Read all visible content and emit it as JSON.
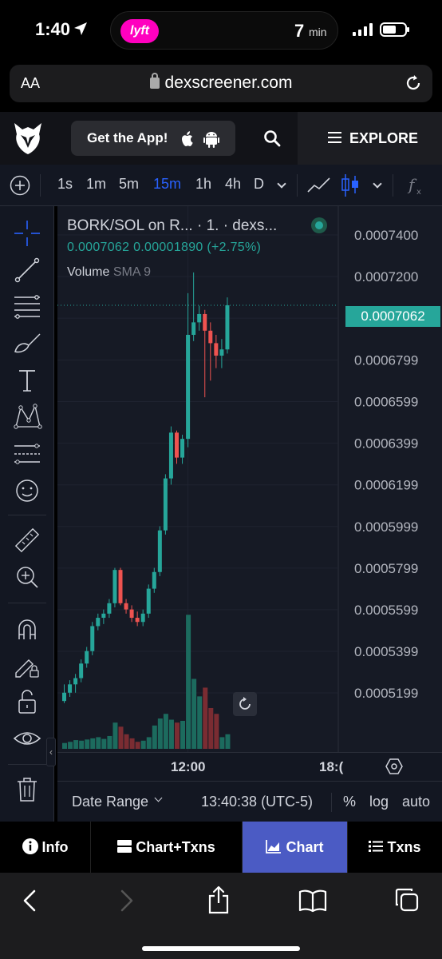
{
  "status_bar": {
    "time": "1:40",
    "eta_number": "7",
    "eta_unit": "min",
    "lyft_label": "lyft"
  },
  "browser": {
    "aa_label": "AA",
    "url": "dexscreener.com"
  },
  "header": {
    "get_app_label": "Get the App!",
    "explore_label": "EXPLORE"
  },
  "toolbar": {
    "intervals": [
      "1s",
      "1m",
      "5m",
      "15m",
      "1h",
      "4h",
      "D"
    ],
    "active_interval": "15m"
  },
  "legend": {
    "title": "BORK/SOL on R...  · 1. · dexs...",
    "values": "0.0007062  0.00001890 (+2.75%)",
    "volume_label": "Volume",
    "volume_indicator": "SMA 9"
  },
  "price_axis": {
    "labels": [
      "0.0007400",
      "0.0007200",
      "0.0007000",
      "0.0006799",
      "0.0006599",
      "0.0006399",
      "0.0006199",
      "0.0005999",
      "0.0005799",
      "0.0005599",
      "0.0005399",
      "0.0005199"
    ],
    "current_price": "0.0007062"
  },
  "time_axis": {
    "labels": [
      "12:00",
      "18:("
    ]
  },
  "bottom_bar": {
    "date_range": "Date Range",
    "clock": "13:40:38 (UTC-5)",
    "percent": "%",
    "log": "log",
    "auto": "auto"
  },
  "tabs": [
    {
      "label": "Info",
      "active": false
    },
    {
      "label": "Chart+Txns",
      "active": false
    },
    {
      "label": "Chart",
      "active": true
    },
    {
      "label": "Txns",
      "active": false
    }
  ],
  "colors": {
    "up": "#26a69a",
    "down": "#ef5350",
    "accent": "#2962ff",
    "tab_active": "#4b5bc4",
    "bg": "#161a25"
  },
  "chart_data": {
    "type": "candlestick",
    "price_range": [
      0.000508,
      0.00075
    ],
    "candles": [
      {
        "o": 0.000516,
        "h": 0.000524,
        "l": 0.000515,
        "c": 0.00052
      },
      {
        "o": 0.00052,
        "h": 0.000526,
        "l": 0.000518,
        "c": 0.000524
      },
      {
        "o": 0.000524,
        "h": 0.000529,
        "l": 0.00052,
        "c": 0.000527
      },
      {
        "o": 0.000527,
        "h": 0.000536,
        "l": 0.000525,
        "c": 0.000534
      },
      {
        "o": 0.000534,
        "h": 0.000542,
        "l": 0.000532,
        "c": 0.00054
      },
      {
        "o": 0.00054,
        "h": 0.000554,
        "l": 0.000538,
        "c": 0.000552
      },
      {
        "o": 0.000552,
        "h": 0.000558,
        "l": 0.00055,
        "c": 0.000556
      },
      {
        "o": 0.000556,
        "h": 0.00056,
        "l": 0.000553,
        "c": 0.000558
      },
      {
        "o": 0.000558,
        "h": 0.000565,
        "l": 0.000556,
        "c": 0.000563
      },
      {
        "o": 0.000563,
        "h": 0.00058,
        "l": 0.000561,
        "c": 0.000579
      },
      {
        "o": 0.000579,
        "h": 0.00058,
        "l": 0.000562,
        "c": 0.000563
      },
      {
        "o": 0.000563,
        "h": 0.000565,
        "l": 0.000558,
        "c": 0.00056
      },
      {
        "o": 0.00056,
        "h": 0.000562,
        "l": 0.000554,
        "c": 0.000556
      },
      {
        "o": 0.000556,
        "h": 0.000559,
        "l": 0.000552,
        "c": 0.000554
      },
      {
        "o": 0.000554,
        "h": 0.00056,
        "l": 0.000552,
        "c": 0.000558
      },
      {
        "o": 0.000558,
        "h": 0.000572,
        "l": 0.000556,
        "c": 0.00057
      },
      {
        "o": 0.00057,
        "h": 0.00058,
        "l": 0.000568,
        "c": 0.000578
      },
      {
        "o": 0.000578,
        "h": 0.0006,
        "l": 0.000576,
        "c": 0.000598
      },
      {
        "o": 0.000598,
        "h": 0.000625,
        "l": 0.000596,
        "c": 0.000623
      },
      {
        "o": 0.000623,
        "h": 0.000648,
        "l": 0.00062,
        "c": 0.000645
      },
      {
        "o": 0.000645,
        "h": 0.000646,
        "l": 0.00063,
        "c": 0.000633
      },
      {
        "o": 0.000633,
        "h": 0.000644,
        "l": 0.00063,
        "c": 0.000642
      },
      {
        "o": 0.000642,
        "h": 0.000712,
        "l": 0.000638,
        "c": 0.000692
      },
      {
        "o": 0.000692,
        "h": 0.000722,
        "l": 0.000689,
        "c": 0.000698
      },
      {
        "o": 0.000698,
        "h": 0.000706,
        "l": 0.000694,
        "c": 0.000702
      },
      {
        "o": 0.000702,
        "h": 0.000704,
        "l": 0.000662,
        "c": 0.000694
      },
      {
        "o": 0.000694,
        "h": 0.000698,
        "l": 0.00067,
        "c": 0.000688
      },
      {
        "o": 0.000688,
        "h": 0.000692,
        "l": 0.000676,
        "c": 0.000682
      },
      {
        "o": 0.000682,
        "h": 0.00069,
        "l": 0.000676,
        "c": 0.000685
      },
      {
        "o": 0.000685,
        "h": 0.00071,
        "l": 0.000683,
        "c": 0.0007062
      }
    ],
    "volume": [
      10,
      12,
      15,
      14,
      16,
      18,
      20,
      17,
      22,
      45,
      38,
      25,
      18,
      12,
      14,
      20,
      40,
      52,
      60,
      50,
      45,
      48,
      230,
      120,
      90,
      105,
      70,
      60,
      20,
      25
    ],
    "volume_max": 240,
    "x_ticks": [
      {
        "index": 22,
        "label": "12:00"
      }
    ]
  }
}
